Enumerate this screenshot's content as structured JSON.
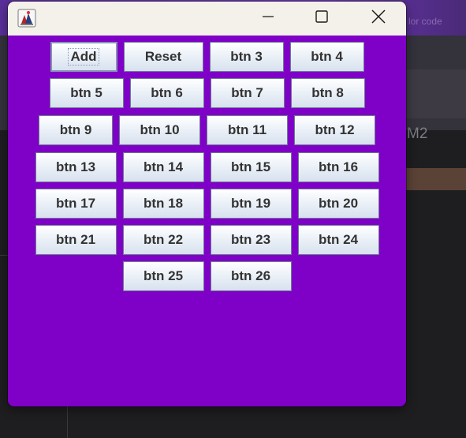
{
  "background": {
    "partial_text": "M2",
    "top_partial_text": "lor code"
  },
  "window": {
    "titlebar": {
      "app_icon": "java-app-icon",
      "minimize_icon": "minimize-icon",
      "maximize_icon": "maximize-icon",
      "close_icon": "close-icon"
    },
    "content_color": "#7f00c6",
    "button_rows": [
      [
        "Add",
        "Reset",
        "btn 3",
        "btn 4"
      ],
      [
        "btn 5",
        "btn 6",
        "btn 7",
        "btn 8"
      ],
      [
        "btn 9",
        "btn 10",
        "btn 11",
        "btn 12"
      ],
      [
        "btn 13",
        "btn 14",
        "btn 15",
        "btn 16"
      ],
      [
        "btn 17",
        "btn 18",
        "btn 19",
        "btn 20"
      ],
      [
        "btn 21",
        "btn 22",
        "btn 23",
        "btn 24"
      ],
      [
        "btn 25",
        "btn 26"
      ]
    ],
    "focused_button": "Add"
  }
}
